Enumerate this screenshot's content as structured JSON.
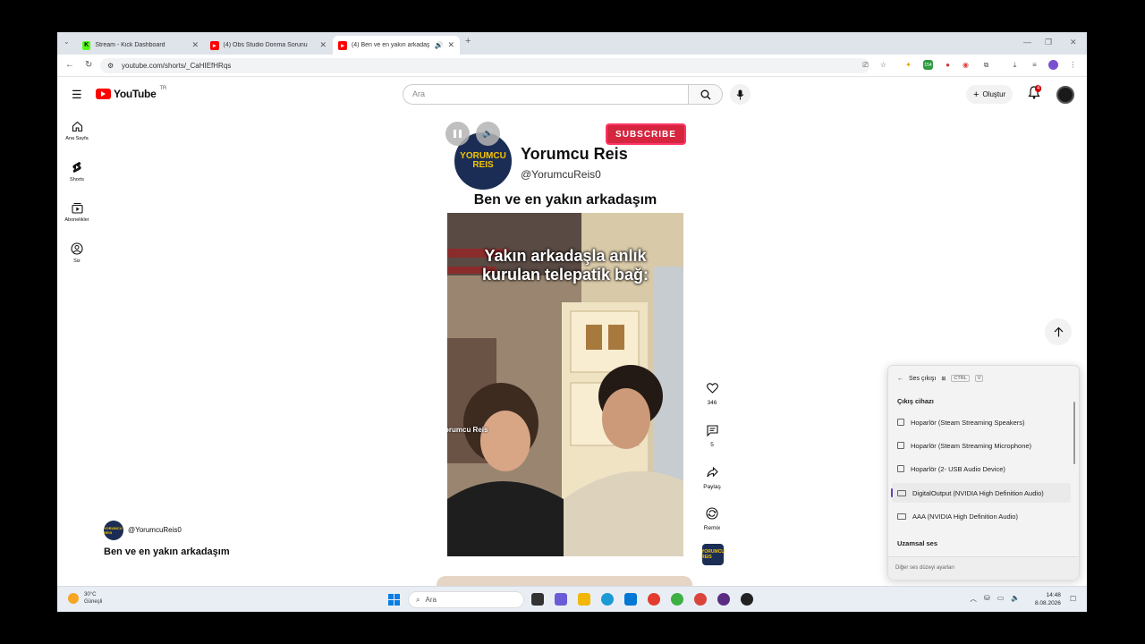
{
  "browser": {
    "tabs": [
      {
        "title": "Stream - Kick Dashboard",
        "icon": "kick-icon"
      },
      {
        "title": "(4) Obs Studio Donma Sorunu",
        "icon": "youtube-icon"
      },
      {
        "title": "(4) Ben ve en yakın arkadaşı",
        "icon": "youtube-icon",
        "active": true
      }
    ],
    "url": "youtube.com/shorts/_CaHIEfHRqs",
    "extension_badge": "154"
  },
  "youtube": {
    "logo_text": "YouTube",
    "region": "TR",
    "search_placeholder": "Ara",
    "create_label": "Oluştur",
    "notification_count": "4",
    "sidebar": [
      {
        "label": "Ana Sayfa",
        "icon": "home-icon"
      },
      {
        "label": "Shorts",
        "icon": "shorts-icon"
      },
      {
        "label": "Abonelikler",
        "icon": "subscriptions-icon"
      },
      {
        "label": "Siz",
        "icon": "you-icon"
      }
    ]
  },
  "short": {
    "channel_logo_text": "YORUMCU REIS",
    "channel_name": "Yorumcu Reis",
    "channel_handle": "@YorumcuReis0",
    "header_title": "Ben ve en yakın arkadaşım",
    "overlay_line1": "Yakın arkadaşla anlık",
    "overlay_line2": "kurulan telepatik bağ:",
    "watermark": "orumcu Reis",
    "subscribe_badge": "SUBSCRIBE",
    "actions": {
      "like_count": "346",
      "comment_count": "5",
      "share_label": "Paylaş",
      "remix_label": "Remix"
    },
    "info_handle": "@YorumcuReis0",
    "info_title": "Ben ve en yakın arkadaşım"
  },
  "sound_panel": {
    "title": "Ses çıkışı",
    "shortcut_ctrl": "CTRL",
    "shortcut_v": "V",
    "section_output": "Çıkış cihazı",
    "devices": [
      {
        "name": "Hoparlör (Steam Streaming Speakers)",
        "selected": false
      },
      {
        "name": "Hoparlör (Steam Streaming Microphone)",
        "selected": false
      },
      {
        "name": "Hoparlör (2- USB Audio Device)",
        "selected": false
      },
      {
        "name": "DigitalOutput (NVIDIA High Definition Audio)",
        "selected": true
      },
      {
        "name": "AAA (NVIDIA High Definition Audio)",
        "selected": false
      }
    ],
    "section_spatial": "Uzamsal ses",
    "footer_link": "Diğer ses düzeyi ayarları"
  },
  "taskbar": {
    "weather_temp": "30°C",
    "weather_desc": "Güneşli",
    "search_label": "Ara",
    "time": "14:48",
    "date": "8.08.2026"
  },
  "colors": {
    "youtube_red": "#ff0000",
    "panel_selected_bar": "#6b3fb0",
    "subscribe_red": "#d20f2b"
  }
}
